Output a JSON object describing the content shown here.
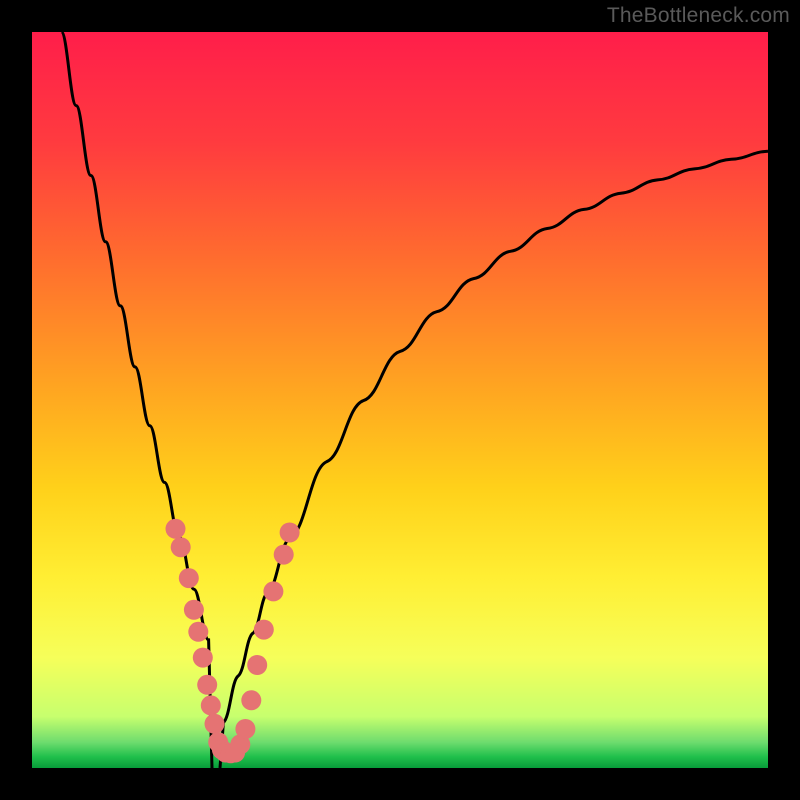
{
  "watermark": "TheBottleneck.com",
  "colors": {
    "gradient_stops": [
      {
        "offset": 0.0,
        "color": "#ff1e4a"
      },
      {
        "offset": 0.15,
        "color": "#ff3b3f"
      },
      {
        "offset": 0.3,
        "color": "#ff6a2f"
      },
      {
        "offset": 0.48,
        "color": "#ffa421"
      },
      {
        "offset": 0.62,
        "color": "#ffd11a"
      },
      {
        "offset": 0.74,
        "color": "#ffee33"
      },
      {
        "offset": 0.85,
        "color": "#f6ff5a"
      },
      {
        "offset": 0.93,
        "color": "#c7ff6e"
      },
      {
        "offset": 0.965,
        "color": "#6edc6e"
      },
      {
        "offset": 0.985,
        "color": "#1fbf4b"
      },
      {
        "offset": 1.0,
        "color": "#089c3a"
      }
    ],
    "curve": "#000000",
    "points": "#e57373"
  },
  "chart_data": {
    "type": "line",
    "title": "",
    "xlabel": "",
    "ylabel": "",
    "xlim": [
      0,
      100
    ],
    "ylim": [
      0,
      100
    ],
    "grid": false,
    "legend": false,
    "notch_x": 25,
    "series": [
      {
        "name": "bottleneck_curve",
        "x": [
          4,
          6,
          8,
          10,
          12,
          14,
          16,
          18,
          20,
          22,
          24,
          25,
          26,
          28,
          30,
          32,
          35,
          40,
          45,
          50,
          55,
          60,
          65,
          70,
          75,
          80,
          85,
          90,
          95,
          100
        ],
        "y": [
          100,
          90,
          80.5,
          71.5,
          62.8,
          54.5,
          46.5,
          38.8,
          31.4,
          24.3,
          17.4,
          0,
          6.2,
          12.5,
          18.3,
          23.8,
          31.2,
          41.6,
          49.9,
          56.6,
          62.0,
          66.5,
          70.2,
          73.3,
          75.9,
          78.1,
          79.9,
          81.4,
          82.7,
          83.8
        ]
      }
    ],
    "points": {
      "name": "sample_markers",
      "values": [
        {
          "x": 19.5,
          "y": 32.5
        },
        {
          "x": 20.2,
          "y": 30.0
        },
        {
          "x": 21.3,
          "y": 25.8
        },
        {
          "x": 22.0,
          "y": 21.5
        },
        {
          "x": 22.6,
          "y": 18.5
        },
        {
          "x": 23.2,
          "y": 15.0
        },
        {
          "x": 23.8,
          "y": 11.3
        },
        {
          "x": 24.3,
          "y": 8.5
        },
        {
          "x": 24.8,
          "y": 6.0
        },
        {
          "x": 25.3,
          "y": 3.5
        },
        {
          "x": 25.8,
          "y": 2.5
        },
        {
          "x": 26.3,
          "y": 2.1
        },
        {
          "x": 27.0,
          "y": 2.0
        },
        {
          "x": 27.6,
          "y": 2.1
        },
        {
          "x": 28.3,
          "y": 3.2
        },
        {
          "x": 29.0,
          "y": 5.3
        },
        {
          "x": 29.8,
          "y": 9.2
        },
        {
          "x": 30.6,
          "y": 14.0
        },
        {
          "x": 31.5,
          "y": 18.8
        },
        {
          "x": 32.8,
          "y": 24.0
        },
        {
          "x": 34.2,
          "y": 29.0
        },
        {
          "x": 35.0,
          "y": 32.0
        }
      ]
    }
  }
}
